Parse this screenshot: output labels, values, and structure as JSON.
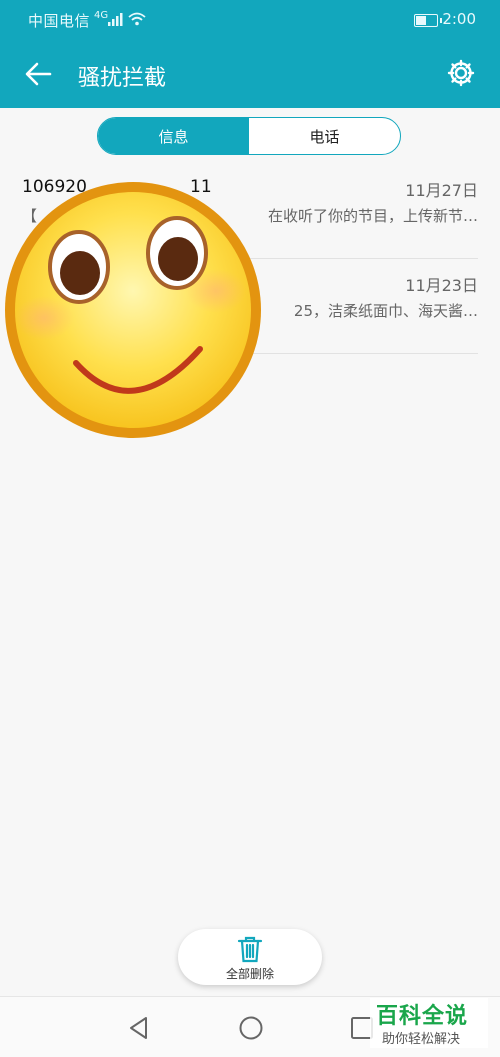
{
  "status_bar": {
    "carrier": "中国电信",
    "network": "4G",
    "time": "2:00"
  },
  "app_bar": {
    "title": "骚扰拦截",
    "back_icon": "arrow-left-icon",
    "settings_icon": "gear-icon"
  },
  "tabs": [
    {
      "label": "信息",
      "active": true
    },
    {
      "label": "电话",
      "active": false
    }
  ],
  "messages": [
    {
      "sender": "106920",
      "sender_tail": "11",
      "date": "11月27日",
      "preview": "【",
      "preview_tail": "在收听了你的节目，上传新节…"
    },
    {
      "sender": "",
      "date": "11月23日",
      "preview": "25，洁柔纸面巾、海天酱…"
    }
  ],
  "delete_button": {
    "label": "全部删除",
    "icon": "trash-icon"
  },
  "nav_bar": {
    "back_icon": "triangle-back-icon",
    "home_icon": "circle-home-icon",
    "recent_icon": "square-recent-icon"
  },
  "watermark": {
    "main": "百科全说",
    "sub": "助你轻松解决"
  },
  "colors": {
    "accent": "#12a7bd",
    "background": "#f7f7f7"
  }
}
